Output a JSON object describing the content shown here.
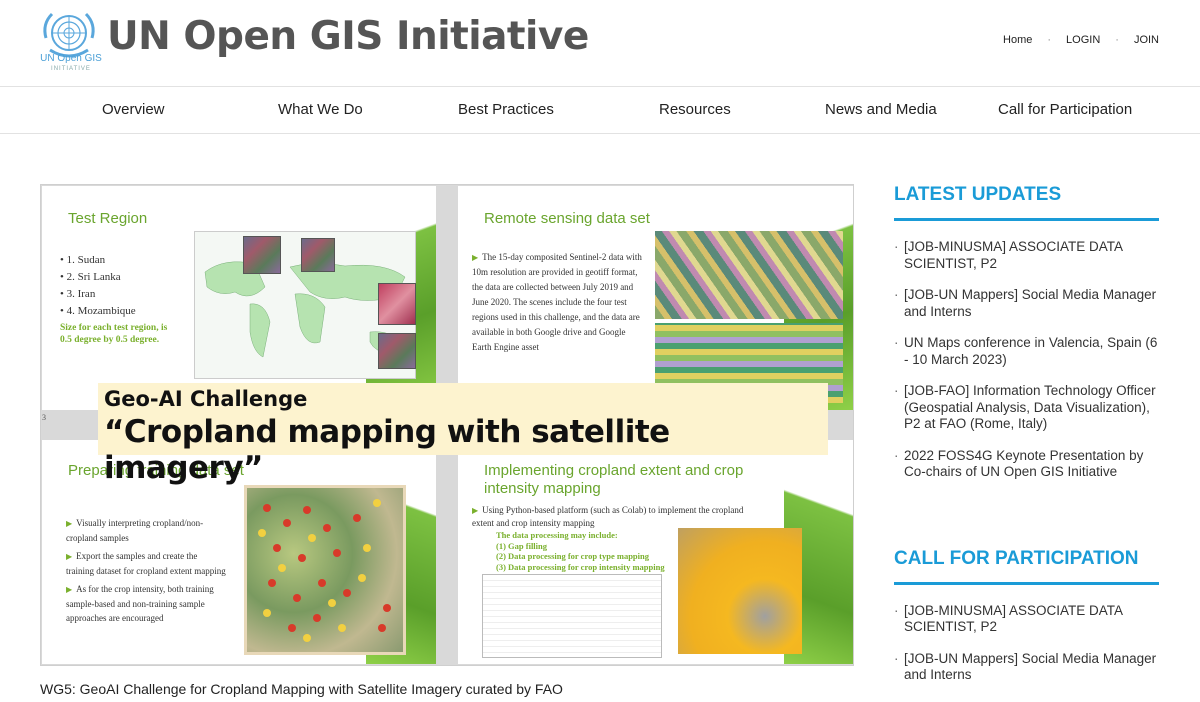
{
  "header": {
    "logo_text": "UN Open GIS",
    "logo_sub": "INITIATIVE",
    "site_title": "UN Open GIS Initiative",
    "top_links": [
      "Home",
      "LOGIN",
      "JOIN"
    ]
  },
  "nav": {
    "items": [
      "Overview",
      "What We Do",
      "Best Practices",
      "Resources",
      "News and Media",
      "Call for Participation"
    ]
  },
  "slides": {
    "test_region": {
      "title": "Test Region",
      "items": [
        "1. Sudan",
        "2. Sri Lanka",
        "3. Iran",
        "4. Mozambique"
      ],
      "note": "Size for each test region, is 0.5 degree by 0.5 degree."
    },
    "remote_sensing": {
      "title": "Remote sensing data set",
      "text": "The 15-day composited Sentinel-2 data with 10m resolution are provided in geotiff format, the data are collected between July 2019 and June 2020. The scenes include the four test regions used in this challenge, and the data are available in both Google drive and Google Earth Engine asset"
    },
    "training": {
      "title": "Preparing training data set",
      "bullets": [
        "Visually interpreting cropland/non-cropland samples",
        "Export the samples and create the training dataset for cropland extent mapping",
        "As for the crop intensity, both training sample-based and non-training sample approaches are encouraged"
      ]
    },
    "implementing": {
      "title": "Implementing cropland extent and crop intensity mapping",
      "text": "Using Python-based platform (such as Colab) to implement the cropland extent and crop intensity mapping",
      "processing_head": "The data processing may include:",
      "processing_items": [
        "(1)  Gap filling",
        "(2)  Data processing for crop type mapping",
        "(3)  Data processing for crop intensity mapping"
      ]
    },
    "slide_number": "3"
  },
  "overlay": {
    "line1": "Geo-AI Challenge",
    "line2": "“Cropland mapping with satellite imagery”"
  },
  "caption": "WG5: GeoAI Challenge for Cropland Mapping with Satellite Imagery curated by FAO",
  "sidebar": {
    "latest_title": "LATEST UPDATES",
    "latest_items": [
      "[JOB-MINUSMA] ASSOCIATE DATA SCIENTIST, P2",
      "[JOB-UN Mappers] Social Media Manager and Interns",
      "UN Maps conference in Valencia, Spain (6 - 10 March 2023)",
      "[JOB-FAO] Information Technology Officer (Geospatial Analysis, Data Visualization), P2 at FAO (Rome, Italy)",
      "2022 FOSS4G Keynote Presentation by Co-chairs of UN Open GIS Initiative"
    ],
    "call_title": "CALL FOR PARTICIPATION",
    "call_items": [
      "[JOB-MINUSMA] ASSOCIATE DATA SCIENTIST, P2",
      "[JOB-UN Mappers] Social Media Manager and Interns"
    ]
  },
  "colors": {
    "accent_blue": "#1a9bd7",
    "slide_green": "#6aa52e",
    "overlay_bg": "#fdf3cf"
  }
}
